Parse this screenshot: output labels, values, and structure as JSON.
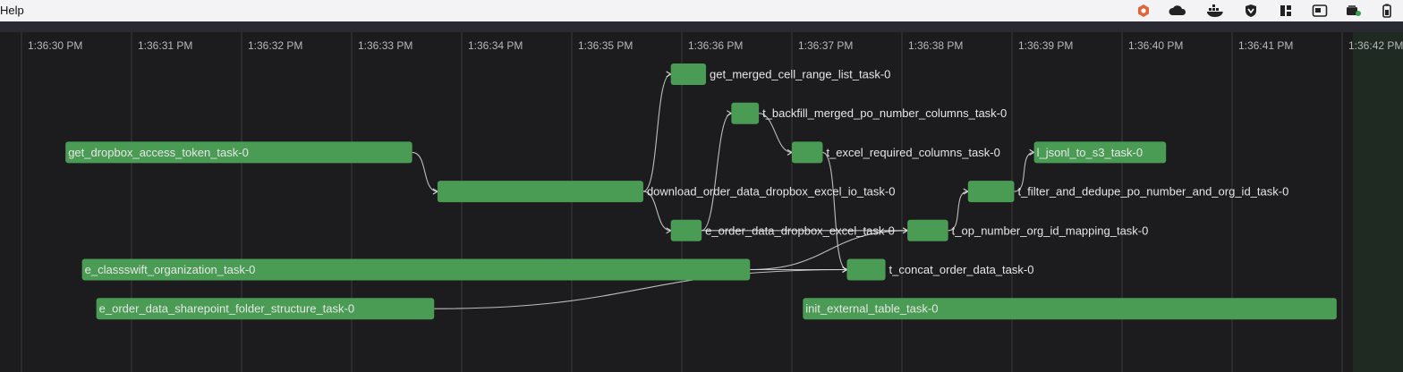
{
  "menubar": {
    "menu_help": "Help",
    "tray_icons": [
      "app-orange-icon",
      "cloud-icon",
      "docker-icon",
      "shield-icon",
      "grid-icon",
      "screen-icon",
      "wallet-icon",
      "battery-icon"
    ]
  },
  "timeline": {
    "ticks": [
      "1:36:30 PM",
      "1:36:31 PM",
      "1:36:32 PM",
      "1:36:33 PM",
      "1:36:34 PM",
      "1:36:35 PM",
      "1:36:36 PM",
      "1:36:37 PM",
      "1:36:38 PM",
      "1:36:39 PM",
      "1:36:40 PM",
      "1:36:41 PM",
      "1:36:42 PM"
    ],
    "colors": {
      "bar": "#4a9c54",
      "line": "#d9d9d9",
      "grid": "#3a3a3e",
      "text": "#e6e6e6",
      "tick": "#b8b8b8"
    }
  },
  "tasks": [
    {
      "id": "get_merged",
      "label": "get_merged_cell_range_list_task-0",
      "label_inside": false,
      "start": "1:36:35.90",
      "end": "1:36:36.22",
      "row": 0
    },
    {
      "id": "backfill",
      "label": "t_backfill_merged_po_number_columns_task-0",
      "label_inside": false,
      "start": "1:36:36.45",
      "end": "1:36:36.70",
      "row": 1
    },
    {
      "id": "get_dropbox",
      "label": "get_dropbox_access_token_task-0",
      "label_inside": true,
      "start": "1:36:30.40",
      "end": "1:36:33.55",
      "row": 2
    },
    {
      "id": "excel_req",
      "label": "t_excel_required_columns_task-0",
      "label_inside": false,
      "start": "1:36:37.00",
      "end": "1:36:37.28",
      "row": 2
    },
    {
      "id": "jsonl",
      "label": "l_jsonl_to_s3_task-0",
      "label_inside": true,
      "start": "1:36:39.20",
      "end": "1:36:40.40",
      "row": 2
    },
    {
      "id": "download",
      "label": "download_order_data_dropbox_excel_io_task-0",
      "label_inside": false,
      "start": "1:36:33.78",
      "end": "1:36:35.65",
      "row": 3
    },
    {
      "id": "filter",
      "label": "t_filter_and_dedupe_po_number_and_org_id_task-0",
      "label_inside": false,
      "start": "1:36:38.60",
      "end": "1:36:39.02",
      "row": 3
    },
    {
      "id": "e_order",
      "label": "e_order_data_dropbox_excel_task-0",
      "label_inside": false,
      "start": "1:36:35.90",
      "end": "1:36:36.18",
      "row": 4
    },
    {
      "id": "op_number",
      "label": "t_op_number_org_id_mapping_task-0",
      "label_inside": false,
      "start": "1:36:38.05",
      "end": "1:36:38.42",
      "row": 4
    },
    {
      "id": "classswift",
      "label": "e_classswift_organization_task-0",
      "label_inside": true,
      "start": "1:36:30.55",
      "end": "1:36:36.62",
      "row": 5
    },
    {
      "id": "concat",
      "label": "t_concat_order_data_task-0",
      "label_inside": false,
      "start": "1:36:37.50",
      "end": "1:36:37.85",
      "row": 5
    },
    {
      "id": "sharepoint",
      "label": "e_order_data_sharepoint_folder_structure_task-0",
      "label_inside": true,
      "start": "1:36:30.68",
      "end": "1:36:33.75",
      "row": 6
    },
    {
      "id": "init_ext",
      "label": "init_external_table_task-0",
      "label_inside": true,
      "start": "1:36:37.10",
      "end": "1:36:41.95",
      "row": 6
    }
  ],
  "dependencies": [
    [
      "get_dropbox",
      "download"
    ],
    [
      "download",
      "get_merged"
    ],
    [
      "download",
      "e_order"
    ],
    [
      "e_order",
      "backfill"
    ],
    [
      "backfill",
      "excel_req"
    ],
    [
      "excel_req",
      "concat"
    ],
    [
      "classswift",
      "concat"
    ],
    [
      "sharepoint",
      "concat"
    ],
    [
      "classswift",
      "op_number"
    ],
    [
      "e_order",
      "op_number"
    ],
    [
      "op_number",
      "filter"
    ],
    [
      "filter",
      "jsonl"
    ]
  ]
}
